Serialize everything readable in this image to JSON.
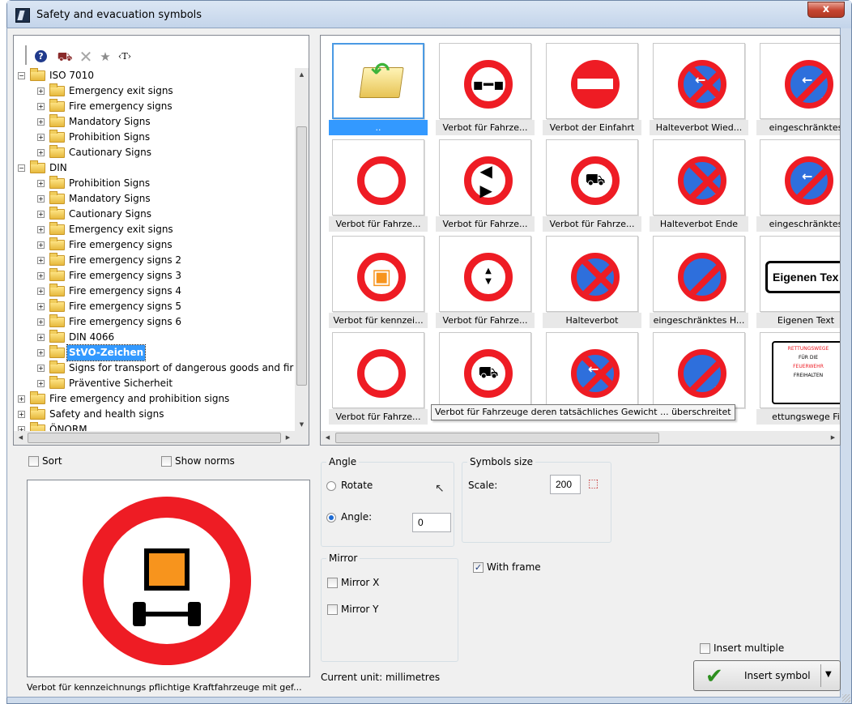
{
  "window": {
    "title": "Safety and evacuation symbols",
    "close_label": "x"
  },
  "toolbar": {
    "help": "?",
    "find": "⛟",
    "delete": "✕",
    "favorite": "★",
    "text": "‹T›"
  },
  "tree": [
    {
      "label": "ISO 7010",
      "level": 0,
      "expanded": true
    },
    {
      "label": "Emergency exit signs",
      "level": 1
    },
    {
      "label": "Fire emergency signs",
      "level": 1
    },
    {
      "label": "Mandatory Signs",
      "level": 1
    },
    {
      "label": "Prohibition Signs",
      "level": 1
    },
    {
      "label": "Cautionary Signs",
      "level": 1
    },
    {
      "label": "DIN",
      "level": 0,
      "expanded": true
    },
    {
      "label": "Prohibition Signs",
      "level": 1
    },
    {
      "label": "Mandatory Signs",
      "level": 1
    },
    {
      "label": "Cautionary Signs",
      "level": 1
    },
    {
      "label": "Emergency exit signs",
      "level": 1
    },
    {
      "label": "Fire emergency signs",
      "level": 1
    },
    {
      "label": "Fire emergency signs 2",
      "level": 1
    },
    {
      "label": "Fire emergency signs 3",
      "level": 1
    },
    {
      "label": "Fire emergency signs 4",
      "level": 1
    },
    {
      "label": "Fire emergency signs 5",
      "level": 1
    },
    {
      "label": "Fire emergency signs 6",
      "level": 1
    },
    {
      "label": "DIN 4066",
      "level": 1
    },
    {
      "label": "StVO-Zeichen",
      "level": 1,
      "selected": true
    },
    {
      "label": "Signs for transport of dangerous goods and fir",
      "level": 1
    },
    {
      "label": "Präventive Sicherheit",
      "level": 1
    },
    {
      "label": "Fire emergency and prohibition signs",
      "level": 0
    },
    {
      "label": "Safety and health signs",
      "level": 0
    },
    {
      "label": "ÖNORM",
      "level": 0
    }
  ],
  "symbols": [
    {
      "caption": "..",
      "kind": "folder-up",
      "selected": true
    },
    {
      "caption": "Verbot für Fahrze...",
      "kind": "ring-axle"
    },
    {
      "caption": "Verbot der Einfahrt",
      "kind": "no-entry"
    },
    {
      "caption": "Halteverbot Wied...",
      "kind": "park-x-both"
    },
    {
      "caption": "eingeschränktes",
      "kind": "park-both"
    },
    {
      "caption": "Verbot für Fahrze...",
      "kind": "ring"
    },
    {
      "caption": "Verbot für Fahrze...",
      "kind": "ring-width"
    },
    {
      "caption": "Verbot für Fahrze...",
      "kind": "ring-water"
    },
    {
      "caption": "Halteverbot Ende",
      "kind": "park-x-right"
    },
    {
      "caption": "eingeschränktes",
      "kind": "park-left"
    },
    {
      "caption": "Verbot für kennzei...",
      "kind": "ring-cargo"
    },
    {
      "caption": "Verbot für Fahrze...",
      "kind": "ring-height"
    },
    {
      "caption": "Halteverbot",
      "kind": "park-x"
    },
    {
      "caption": "eingeschränktes H...",
      "kind": "park"
    },
    {
      "caption": "Eigenen Text",
      "kind": "text",
      "sign_text": "Eigenen Tex"
    },
    {
      "caption": "Verbot für Fahrze...",
      "kind": "ring"
    },
    {
      "caption": "",
      "kind": "ring-truck"
    },
    {
      "caption": "",
      "kind": "park-x-left"
    },
    {
      "caption": "",
      "kind": "park-right"
    },
    {
      "caption": "ettungswege Fi",
      "kind": "poster",
      "poster_lines": [
        "RETTUNGSWEGE",
        "FÜR DIE",
        "FEUERWEHR",
        "FREIHALTEN"
      ]
    }
  ],
  "tooltip": "Verbot für Fahrzeuge deren tatsächliches Gewicht ... überschreitet",
  "left_options": {
    "sort": "Sort",
    "show_norms": "Show norms"
  },
  "angle": {
    "title": "Angle",
    "rotate": "Rotate",
    "angle_label": "Angle:",
    "angle_value": "0"
  },
  "symbols_size": {
    "title": "Symbols size",
    "scale_label": "Scale:",
    "scale_value": "200"
  },
  "mirror": {
    "title": "Mirror",
    "x": "Mirror X",
    "y": "Mirror Y"
  },
  "with_frame": {
    "label": "With frame",
    "checked": true
  },
  "current_unit": "Current unit: millimetres",
  "insert_multiple": "Insert multiple",
  "insert_button": "Insert symbol",
  "preview_description": "Verbot für kennzeichnungs pflichtige Kraftfahrzeuge mit gef...",
  "colors": {
    "sign_red": "#ee1c24",
    "sign_blue": "#2e6fdc",
    "selection": "#3399ff",
    "cargo_orange": "#f7941d"
  }
}
